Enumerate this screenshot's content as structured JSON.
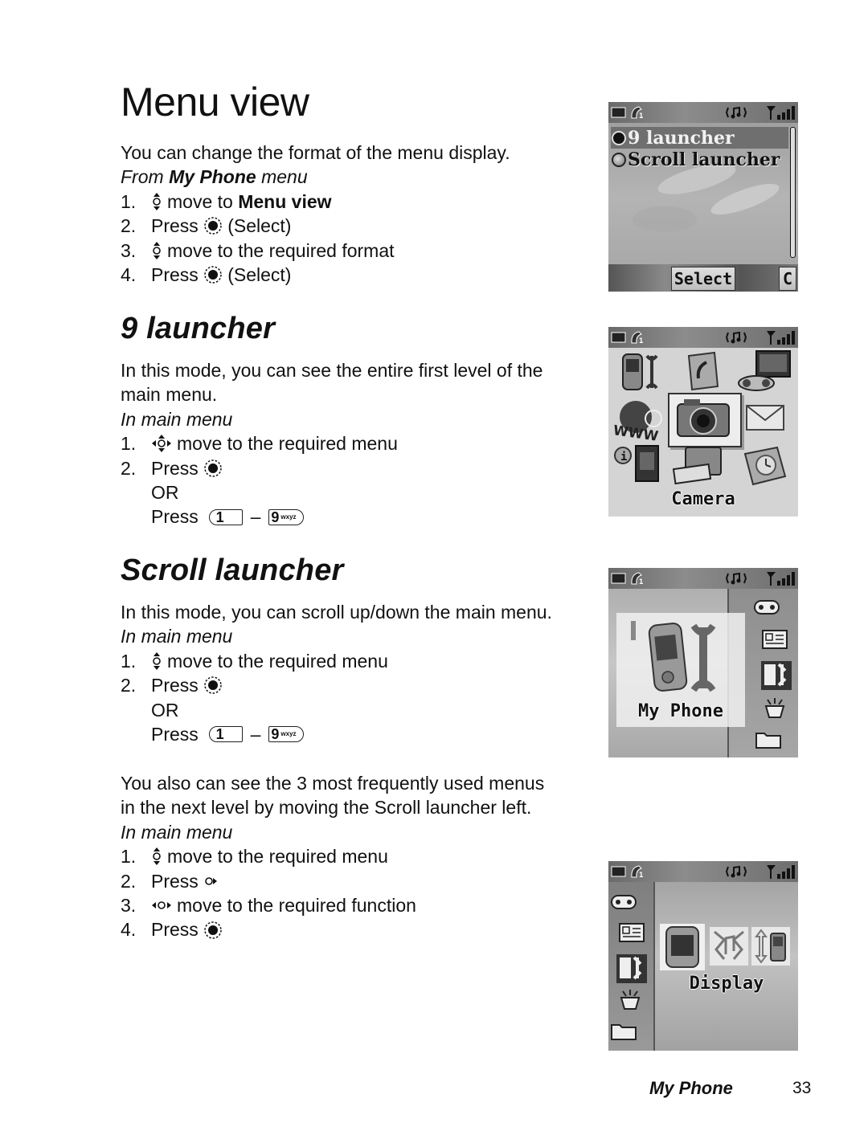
{
  "page": {
    "title": "Menu view",
    "intro": "You can change the format of the menu display.",
    "from_prefix": "From ",
    "from_bold": "My Phone",
    "from_suffix": " menu",
    "steps": [
      {
        "num": "1.",
        "icon": "nav-up-down-icon",
        "text_before": "move to ",
        "text_bold": "Menu view"
      },
      {
        "num": "2.",
        "icon": "select-key-icon",
        "text_before": "Press",
        "text_after": "(Select)"
      },
      {
        "num": "3.",
        "icon": "nav-up-down-icon",
        "text_before": "move to the required format"
      },
      {
        "num": "4.",
        "icon": "select-key-icon",
        "text_before": "Press",
        "text_after": "(Select)"
      }
    ]
  },
  "nine_launcher": {
    "title": "9 launcher",
    "desc_line1": "In this mode, you can see the entire first level of the",
    "desc_line2": "main menu.",
    "context": "In main menu",
    "steps": [
      {
        "num": "1.",
        "icon": "nav-4way-icon",
        "text": "move to the required menu"
      },
      {
        "num": "2.",
        "icon": "select-key-icon",
        "text": "Press"
      },
      {
        "text": "OR"
      },
      {
        "text": "Press",
        "key_from": "1",
        "key_to": "9",
        "key_to_letters": "wxyz",
        "dash": "–"
      }
    ]
  },
  "scroll_launcher": {
    "title": "Scroll launcher",
    "desc": "In this mode, you can scroll up/down the main menu.",
    "context": "In main menu",
    "steps": [
      {
        "num": "1.",
        "icon": "nav-up-down-icon",
        "text": "move to the required menu"
      },
      {
        "num": "2.",
        "icon": "select-key-icon",
        "text": "Press"
      },
      {
        "text": "OR"
      },
      {
        "text": "Press",
        "key_from": "1",
        "key_to": "9",
        "key_to_letters": "wxyz",
        "dash": "–"
      }
    ],
    "extra_line1": "You also can see the 3 most frequently used menus",
    "extra_line2": "in the next level by moving the Scroll launcher left.",
    "extra_context": "In main menu",
    "extra_steps": [
      {
        "num": "1.",
        "icon": "nav-up-down-icon",
        "text": "move to the required menu"
      },
      {
        "num": "2.",
        "icon": "nav-right-icon",
        "text": "Press"
      },
      {
        "num": "3.",
        "icon": "nav-left-right-icon",
        "text": "move to the required function"
      },
      {
        "num": "4.",
        "icon": "select-key-icon",
        "text": "Press"
      }
    ]
  },
  "screens": {
    "menu_view": {
      "options": [
        "9 launcher",
        "Scroll launcher"
      ],
      "selected_index": 0,
      "softkey_left": "Select",
      "softkey_right": "C"
    },
    "nine_grid": {
      "label": "Camera",
      "icons": [
        "my-phone-icon",
        "call-log-icon",
        "games-icon",
        "www-icon",
        "camera-icon",
        "messages-icon",
        "info-icon",
        "media-icon",
        "organiser-icon"
      ]
    },
    "scroll": {
      "label": "My Phone",
      "side_icons": [
        "games-icon",
        "phonebook-icon",
        "my-phone-icon",
        "fun-icon",
        "folder-icon"
      ]
    },
    "scroll_sub": {
      "label": "Display",
      "side_icons": [
        "games-icon",
        "phonebook-icon",
        "my-phone-icon",
        "fun-icon",
        "folder-icon"
      ]
    },
    "status": {
      "line": "1"
    }
  },
  "footer": {
    "section": "My Phone",
    "page_number": "33"
  }
}
